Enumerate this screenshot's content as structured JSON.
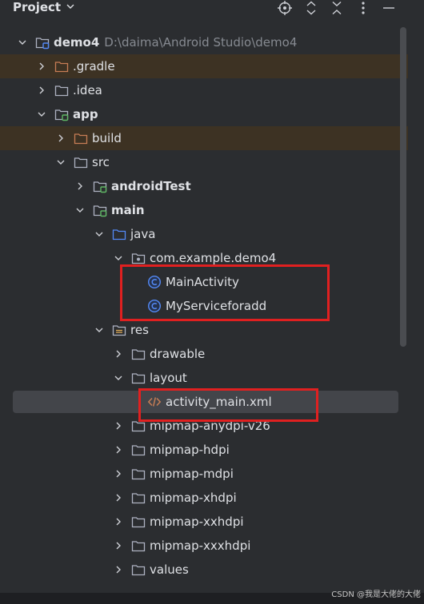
{
  "header": {
    "title": "Project",
    "icons": [
      "crosshair-icon",
      "expand-icon",
      "collapse-icon",
      "more-icon",
      "minimize-icon"
    ]
  },
  "tree": [
    {
      "label": "demo4",
      "path": "D:\\daima\\Android Studio\\demo4",
      "bold": true,
      "expanded": true,
      "icon": "module-folder"
    },
    {
      "label": ".gradle",
      "expanded": false,
      "icon": "folder-excluded"
    },
    {
      "label": ".idea",
      "expanded": false,
      "icon": "folder"
    },
    {
      "label": "app",
      "bold": true,
      "expanded": true,
      "icon": "module-folder"
    },
    {
      "label": "build",
      "expanded": false,
      "icon": "folder-excluded"
    },
    {
      "label": "src",
      "expanded": true,
      "icon": "folder"
    },
    {
      "label": "androidTest",
      "bold": true,
      "expanded": false,
      "icon": "module-folder"
    },
    {
      "label": "main",
      "bold": true,
      "expanded": true,
      "icon": "module-folder"
    },
    {
      "label": "java",
      "expanded": true,
      "icon": "source-folder"
    },
    {
      "label": "com.example.demo4",
      "expanded": true,
      "icon": "package"
    },
    {
      "label": "MainActivity",
      "icon": "class"
    },
    {
      "label": "MyServiceforadd",
      "icon": "class"
    },
    {
      "label": "res",
      "expanded": true,
      "icon": "resource-folder"
    },
    {
      "label": "drawable",
      "expanded": false,
      "icon": "folder"
    },
    {
      "label": "layout",
      "expanded": true,
      "icon": "folder"
    },
    {
      "label": "activity_main.xml",
      "icon": "xml-file",
      "selected": true
    },
    {
      "label": "mipmap-anydpi-v26",
      "expanded": false,
      "icon": "folder"
    },
    {
      "label": "mipmap-hdpi",
      "expanded": false,
      "icon": "folder"
    },
    {
      "label": "mipmap-mdpi",
      "expanded": false,
      "icon": "folder"
    },
    {
      "label": "mipmap-xhdpi",
      "expanded": false,
      "icon": "folder"
    },
    {
      "label": "mipmap-xxhdpi",
      "expanded": false,
      "icon": "folder"
    },
    {
      "label": "mipmap-xxxhdpi",
      "expanded": false,
      "icon": "folder"
    },
    {
      "label": "values",
      "expanded": false,
      "icon": "folder"
    }
  ],
  "watermark": "CSDN @我是大佬的大佬",
  "colors": {
    "background": "#2b2d30",
    "excluded_highlight": "#3d3223",
    "selection": "#43454a",
    "annotation_red": "#e02020",
    "folder": "#aeb3c2",
    "folder_excluded": "#c77d55",
    "source_folder": "#548af7",
    "class_icon": "#548af7",
    "xml_icon": "#c77d55",
    "module_badge": "#5fb865"
  }
}
